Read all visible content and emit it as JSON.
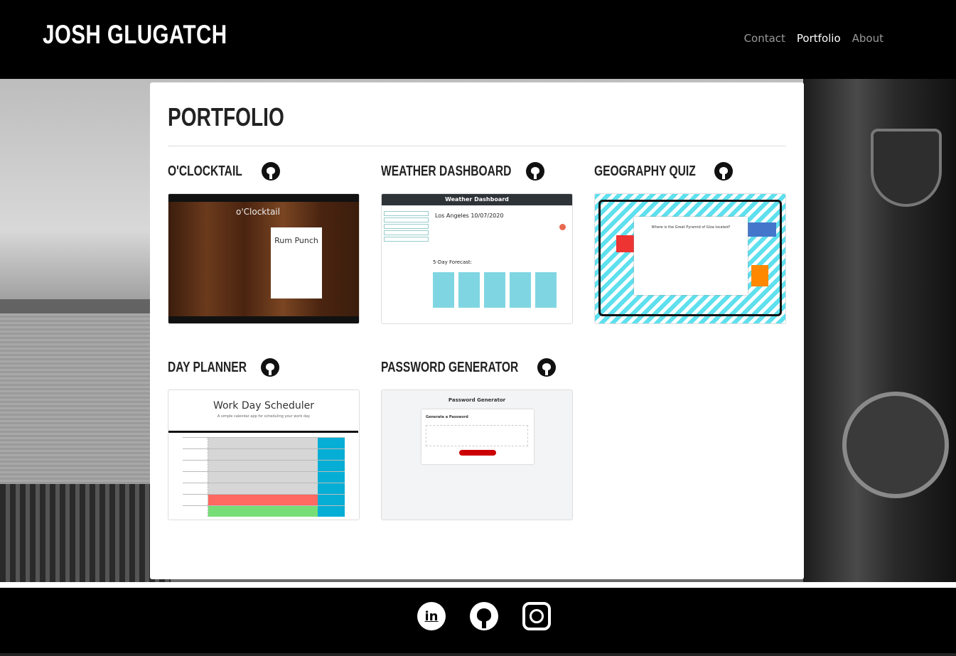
{
  "header": {
    "brand": "JOSH GLUGATCH",
    "nav": [
      {
        "label": "Contact",
        "active": false
      },
      {
        "label": "Portfolio",
        "active": true
      },
      {
        "label": "About",
        "active": false
      }
    ]
  },
  "portfolio": {
    "title": "PORTFOLIO",
    "projects": [
      {
        "name": "O'CLOCKTAIL",
        "thumb_title": "o'Clocktail",
        "thumb_sub": "Rum Punch"
      },
      {
        "name": "WEATHER DASHBOARD",
        "thumb_title": "Weather Dashboard",
        "thumb_city": "Los Angeles 10/07/2020",
        "thumb_forecast": "5-Day Forecast:"
      },
      {
        "name": "GEOGRAPHY QUIZ",
        "thumb_question": "Where is the Great Pyramid of Giza located?"
      },
      {
        "name": "DAY PLANNER",
        "thumb_title": "Work Day Scheduler",
        "thumb_sub": "A simple calendar app for scheduling your work day"
      },
      {
        "name": "PASSWORD GENERATOR",
        "thumb_title": "Password Generator",
        "thumb_sub": "Generate a Password"
      }
    ]
  },
  "footer": {
    "social": [
      {
        "icon": "linkedin-icon",
        "glyph": "in"
      },
      {
        "icon": "github-icon",
        "glyph": ""
      },
      {
        "icon": "instagram-icon",
        "glyph": ""
      }
    ]
  }
}
